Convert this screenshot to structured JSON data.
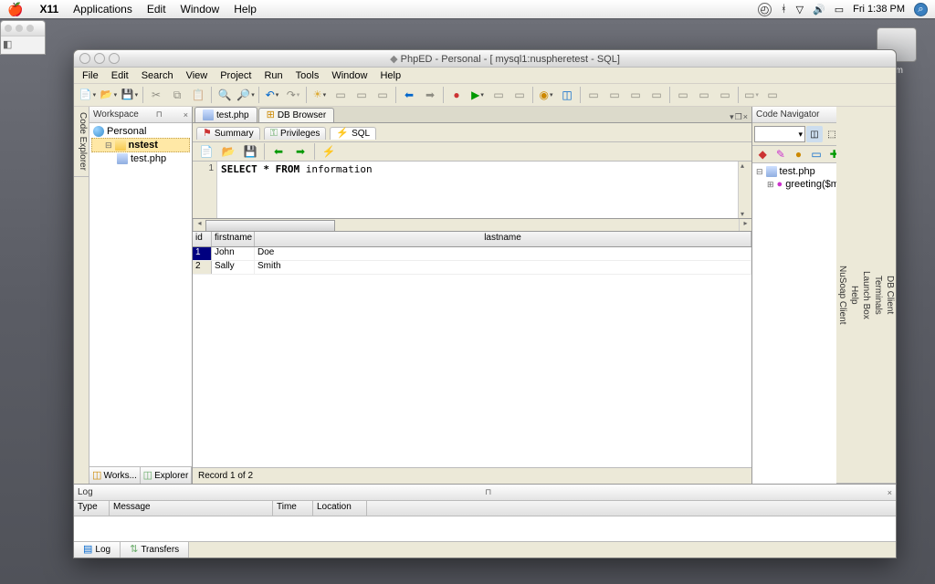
{
  "mac_menu": {
    "app": "X11",
    "items": [
      "Applications",
      "Edit",
      "Window",
      "Help"
    ],
    "clock": "Fri 1:38 PM"
  },
  "desktop": {
    "hd_label": "um"
  },
  "window": {
    "title": "PhpED - Personal - [ mysql1:nuspheretest - SQL]"
  },
  "app_menu": [
    "File",
    "Edit",
    "Search",
    "View",
    "Project",
    "Run",
    "Tools",
    "Window",
    "Help"
  ],
  "workspace": {
    "title": "Workspace",
    "root": "Personal",
    "project": "nstest",
    "file": "test.php",
    "tabs": [
      "Works...",
      "Explorer"
    ]
  },
  "left_sidebar_tabs": [
    "Code Explorer"
  ],
  "right_sidebar_tabs": [
    "DB Client",
    "Terminals",
    "Launch Box",
    "Help",
    "NuSoap Client"
  ],
  "doc_tabs": [
    {
      "label": "test.php"
    },
    {
      "label": "DB Browser",
      "active": true
    }
  ],
  "sub_tabs": [
    {
      "label": "Summary"
    },
    {
      "label": "Privileges"
    },
    {
      "label": "SQL",
      "active": true
    }
  ],
  "sql": {
    "line": "1",
    "query_kw": "SELECT * FROM",
    "query_rest": " information"
  },
  "grid": {
    "columns": [
      "id",
      "firstname",
      "lastname"
    ],
    "rows": [
      {
        "id": "1",
        "firstname": "John",
        "lastname": "Doe"
      },
      {
        "id": "2",
        "firstname": "Sally",
        "lastname": "Smith"
      }
    ],
    "status": "Record 1 of 2"
  },
  "code_nav": {
    "title": "Code Navigator",
    "file": "test.php",
    "item": "greeting($message)"
  },
  "log": {
    "title": "Log",
    "columns": [
      "Type",
      "Message",
      "Time",
      "Location"
    ],
    "tabs": [
      "Log",
      "Transfers"
    ]
  }
}
